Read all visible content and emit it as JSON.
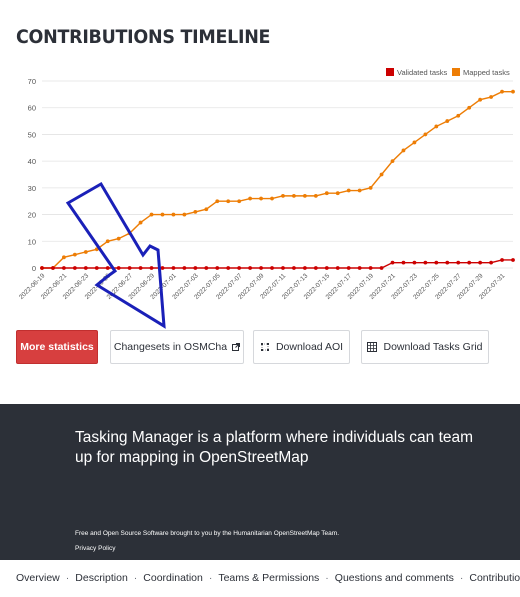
{
  "page": {
    "title": "CONTRIBUTIONS TIMELINE"
  },
  "chart_data": {
    "type": "line",
    "title": "",
    "xlabel": "",
    "ylabel": "",
    "ylim": [
      0,
      70
    ],
    "yticks": [
      "0",
      "10",
      "20",
      "30",
      "40",
      "50",
      "60",
      "70"
    ],
    "grid": true,
    "legend_position": "top-right",
    "x_tick_labels": [
      "2022-06-19",
      "2022-06-21",
      "2022-06-23",
      "2022-06-25",
      "2022-06-27",
      "2022-06-29",
      "2022-07-01",
      "2022-07-03",
      "2022-07-05",
      "2022-07-07",
      "2022-07-09",
      "2022-07-11",
      "2022-07-13",
      "2022-07-15",
      "2022-07-17",
      "2022-07-19",
      "2022-07-21",
      "2022-07-23",
      "2022-07-25",
      "2022-07-27",
      "2022-07-29",
      "2022-07-31"
    ],
    "x": [
      "2022-06-19",
      "2022-06-20",
      "2022-06-21",
      "2022-06-22",
      "2022-06-23",
      "2022-06-24",
      "2022-06-25",
      "2022-06-26",
      "2022-06-27",
      "2022-06-28",
      "2022-06-29",
      "2022-06-30",
      "2022-07-01",
      "2022-07-02",
      "2022-07-03",
      "2022-07-04",
      "2022-07-05",
      "2022-07-06",
      "2022-07-07",
      "2022-07-08",
      "2022-07-09",
      "2022-07-10",
      "2022-07-11",
      "2022-07-12",
      "2022-07-13",
      "2022-07-14",
      "2022-07-15",
      "2022-07-16",
      "2022-07-17",
      "2022-07-18",
      "2022-07-19",
      "2022-07-20",
      "2022-07-21",
      "2022-07-22",
      "2022-07-23",
      "2022-07-24",
      "2022-07-25",
      "2022-07-26",
      "2022-07-27",
      "2022-07-28",
      "2022-07-29",
      "2022-07-30",
      "2022-07-31",
      "2022-08-01"
    ],
    "series": [
      {
        "name": "Validated tasks",
        "color": "#cc0000",
        "values": [
          0,
          0,
          0,
          0,
          0,
          0,
          0,
          0,
          0,
          0,
          0,
          0,
          0,
          0,
          0,
          0,
          0,
          0,
          0,
          0,
          0,
          0,
          0,
          0,
          0,
          0,
          0,
          0,
          0,
          0,
          0,
          0,
          2,
          2,
          2,
          2,
          2,
          2,
          2,
          2,
          2,
          2,
          3,
          3
        ]
      },
      {
        "name": "Mapped tasks",
        "color": "#ed7d05",
        "values": [
          0,
          0,
          4,
          5,
          6,
          7,
          10,
          11,
          13,
          17,
          20,
          20,
          20,
          20,
          21,
          22,
          25,
          25,
          25,
          26,
          26,
          26,
          27,
          27,
          27,
          27,
          28,
          28,
          29,
          29,
          30,
          35,
          40,
          44,
          47,
          50,
          53,
          55,
          57,
          60,
          63,
          64,
          66,
          66
        ]
      }
    ]
  },
  "buttons": {
    "more_statistics": "More statistics",
    "osmcha": "Changesets in OSMCha",
    "download_aoi": "Download AOI",
    "download_grid": "Download Tasks Grid"
  },
  "icons": {
    "external": "external-link-icon",
    "aoi": "aoi-icon",
    "grid": "grid-icon"
  },
  "footer": {
    "headline": "Tasking Manager is a platform where individuals can team up for mapping in OpenStreetMap",
    "small": "Free and Open Source Software brought to you by the Humanitarian OpenStreetMap Team.",
    "privacy": "Privacy Policy"
  },
  "bottom_nav": [
    "Overview",
    "Description",
    "Coordination",
    "Teams & Permissions",
    "Questions and comments",
    "Contributions"
  ],
  "colors": {
    "primary_button": "#d73f3f",
    "footer_bg": "#2c3038",
    "annotation_arrow": "#1a20b8"
  }
}
